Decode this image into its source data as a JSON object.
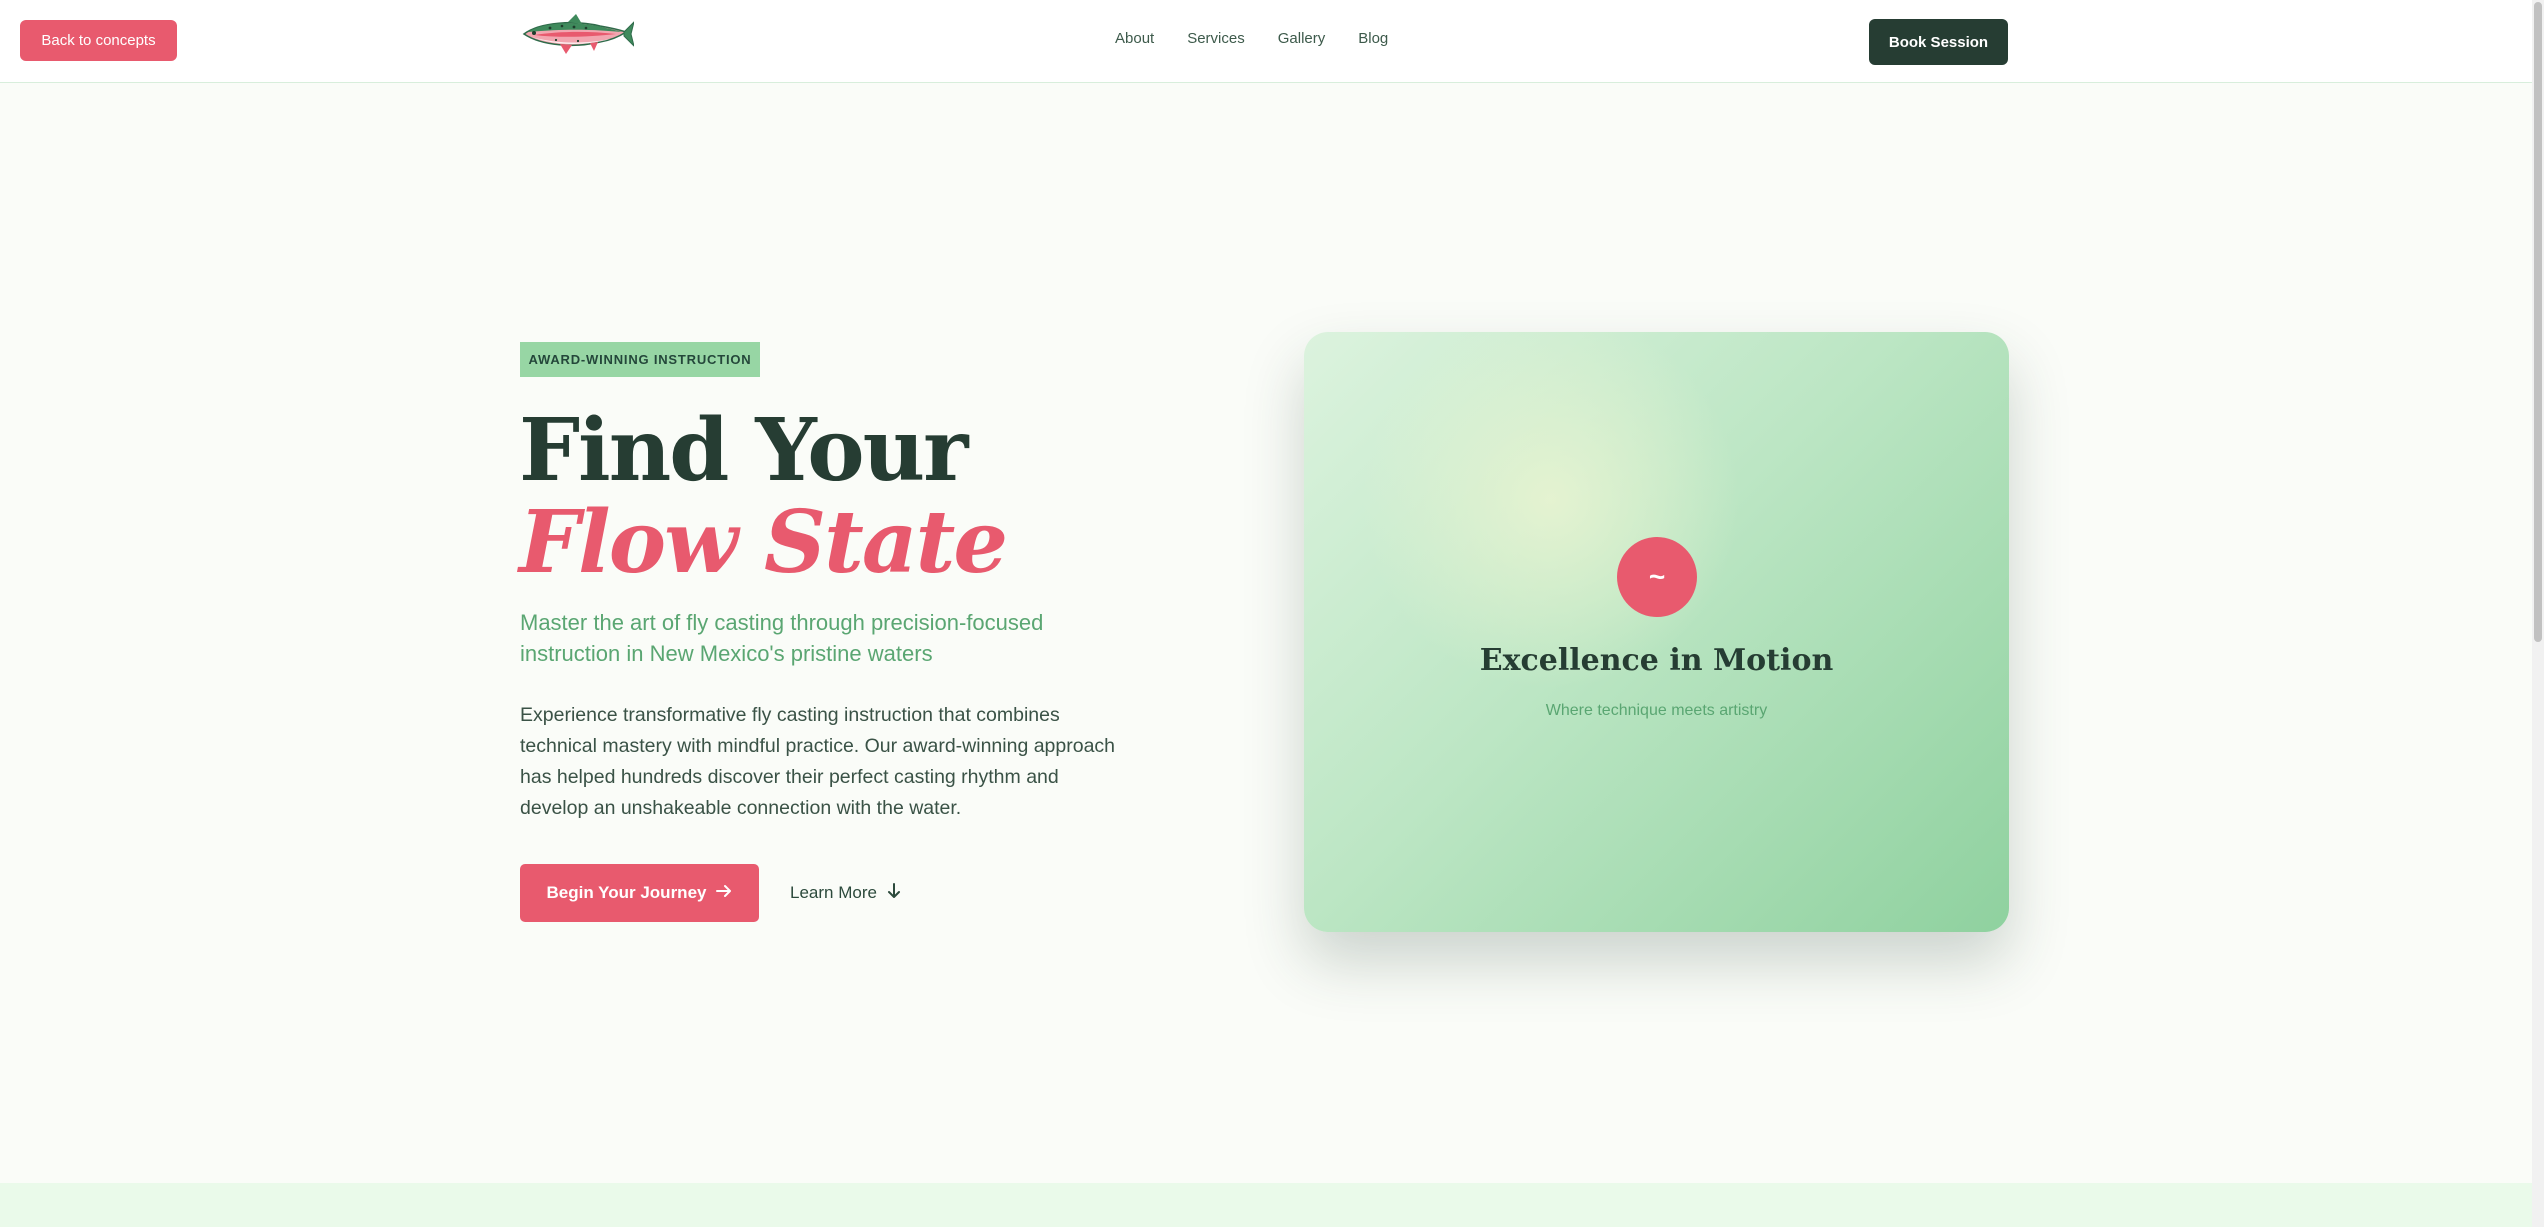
{
  "header": {
    "back_label": "Back to concepts",
    "nav": [
      "About",
      "Services",
      "Gallery",
      "Blog"
    ],
    "book_label": "Book Session"
  },
  "hero": {
    "badge": "AWARD-WINNING INSTRUCTION",
    "title_plain": "Find Your",
    "title_accent": "Flow State",
    "subtitle": "Master the art of fly casting through precision-focused instruction in New Mexico's pristine waters",
    "description": "Experience transformative fly casting instruction that combines technical mastery with mindful practice. Our award-winning approach has helped hundreds discover their perfect casting rhythm and develop an unshakeable connection with the water.",
    "primary_cta": "Begin Your Journey",
    "primary_cta_icon": "arrow-right-icon",
    "secondary_cta": "Learn More",
    "secondary_cta_icon": "arrow-down-icon"
  },
  "card": {
    "icon_glyph": "~",
    "title": "Excellence in Motion",
    "subtitle": "Where technique meets artistry"
  },
  "colors": {
    "accent": "#e85a6e",
    "dark": "#263d33",
    "green": "#5aa672",
    "badge_bg": "#97d6a4"
  }
}
